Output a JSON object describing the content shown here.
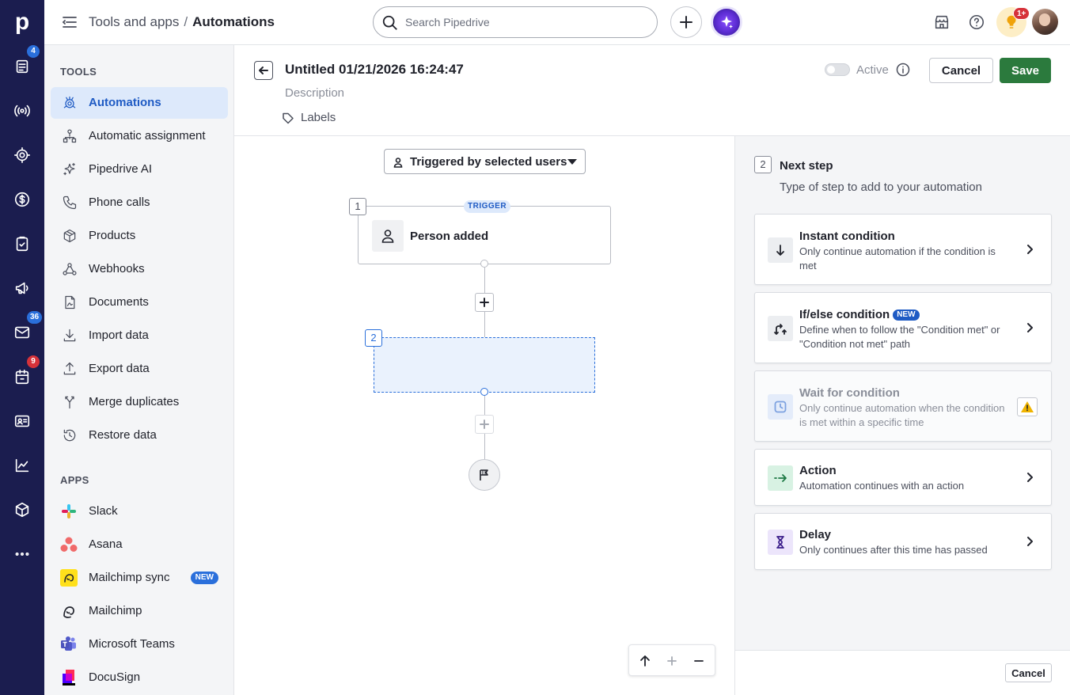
{
  "app": {
    "logo_letter": "p"
  },
  "rail": {
    "badges": {
      "leads": "4",
      "mail": "36",
      "calendar": "9"
    }
  },
  "topbar": {
    "breadcrumb_parent": "Tools and apps",
    "breadcrumb_separator": "/",
    "breadcrumb_current": "Automations",
    "search_placeholder": "Search Pipedrive",
    "notifications_badge": "1+"
  },
  "sidebar": {
    "tools_title": "TOOLS",
    "tools": [
      {
        "label": "Automations",
        "icon": "automations-icon",
        "active": true
      },
      {
        "label": "Automatic assignment",
        "icon": "assignment-icon"
      },
      {
        "label": "Pipedrive AI",
        "icon": "sparkle-icon"
      },
      {
        "label": "Phone calls",
        "icon": "phone-icon"
      },
      {
        "label": "Products",
        "icon": "box-icon"
      },
      {
        "label": "Webhooks",
        "icon": "webhook-icon"
      },
      {
        "label": "Documents",
        "icon": "document-icon"
      },
      {
        "label": "Import data",
        "icon": "download-icon"
      },
      {
        "label": "Export data",
        "icon": "upload-icon"
      },
      {
        "label": "Merge duplicates",
        "icon": "merge-icon"
      },
      {
        "label": "Restore data",
        "icon": "restore-icon"
      }
    ],
    "apps_title": "APPS",
    "apps": [
      {
        "label": "Slack",
        "icon": "slack-icon"
      },
      {
        "label": "Asana",
        "icon": "asana-icon"
      },
      {
        "label": "Mailchimp sync",
        "icon": "mailchimp-icon",
        "badge": "NEW"
      },
      {
        "label": "Mailchimp",
        "icon": "mailchimp-icon"
      },
      {
        "label": "Microsoft Teams",
        "icon": "teams-icon"
      },
      {
        "label": "DocuSign",
        "icon": "docusign-icon"
      }
    ]
  },
  "header": {
    "title": "Untitled 01/21/2026 16:24:47",
    "description_placeholder": "Description",
    "labels": "Labels",
    "active_label": "Active",
    "active_on": false,
    "cancel": "Cancel",
    "save": "Save"
  },
  "canvas": {
    "trigger_dropdown": "Triggered by selected users",
    "node1": {
      "number": "1",
      "tag": "TRIGGER",
      "label": "Person added"
    },
    "node2": {
      "number": "2"
    }
  },
  "panel": {
    "step_number": "2",
    "title": "Next step",
    "subtitle": "Type of step to add to your automation",
    "options": [
      {
        "title": "Instant condition",
        "desc": "Only continue automation if the condition is met",
        "icon": "arrow-down-icon"
      },
      {
        "title": "If/else condition",
        "badge": "NEW",
        "desc": "Define when to follow the \"Condition met\" or \"Condition not met\" path",
        "icon": "branch-icon"
      },
      {
        "title": "Wait for condition",
        "desc": "Only continue automation when the condition is met within a specific time",
        "icon": "clock-icon",
        "disabled": true
      },
      {
        "title": "Action",
        "desc": "Automation continues with an action",
        "icon": "action-arrow-icon"
      },
      {
        "title": "Delay",
        "desc": "Only continues after this time has passed",
        "icon": "hourglass-icon"
      }
    ],
    "footer_cancel": "Cancel"
  },
  "colors": {
    "rail_bg": "#1b1d4f",
    "accent_blue": "#1f5bc4",
    "save_green": "#2b7a3d",
    "badge_red": "#d6323a",
    "warning_yellow": "#f0b400"
  }
}
